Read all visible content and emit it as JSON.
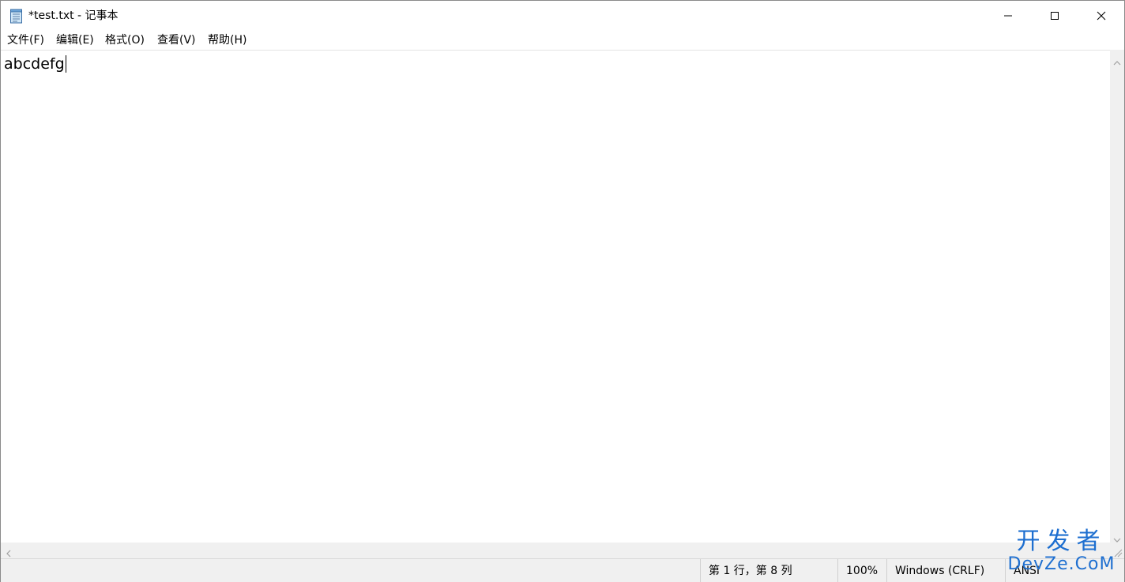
{
  "window": {
    "title": "*test.txt - 记事本",
    "controls": {
      "minimize": "minimize-icon",
      "maximize": "maximize-icon",
      "close": "close-icon"
    }
  },
  "menu": {
    "items": [
      {
        "label": "文件(F)"
      },
      {
        "label": "编辑(E)"
      },
      {
        "label": "格式(O)"
      },
      {
        "label": "查看(V)"
      },
      {
        "label": "帮助(H)"
      }
    ]
  },
  "editor": {
    "content": "abcdefg"
  },
  "status": {
    "position": "第 1 行，第 8 列",
    "zoom": "100%",
    "line_ending": "Windows (CRLF)",
    "encoding": "ANSI"
  },
  "watermark": {
    "top": "开发者",
    "bottom": "DevZe.CoM"
  }
}
